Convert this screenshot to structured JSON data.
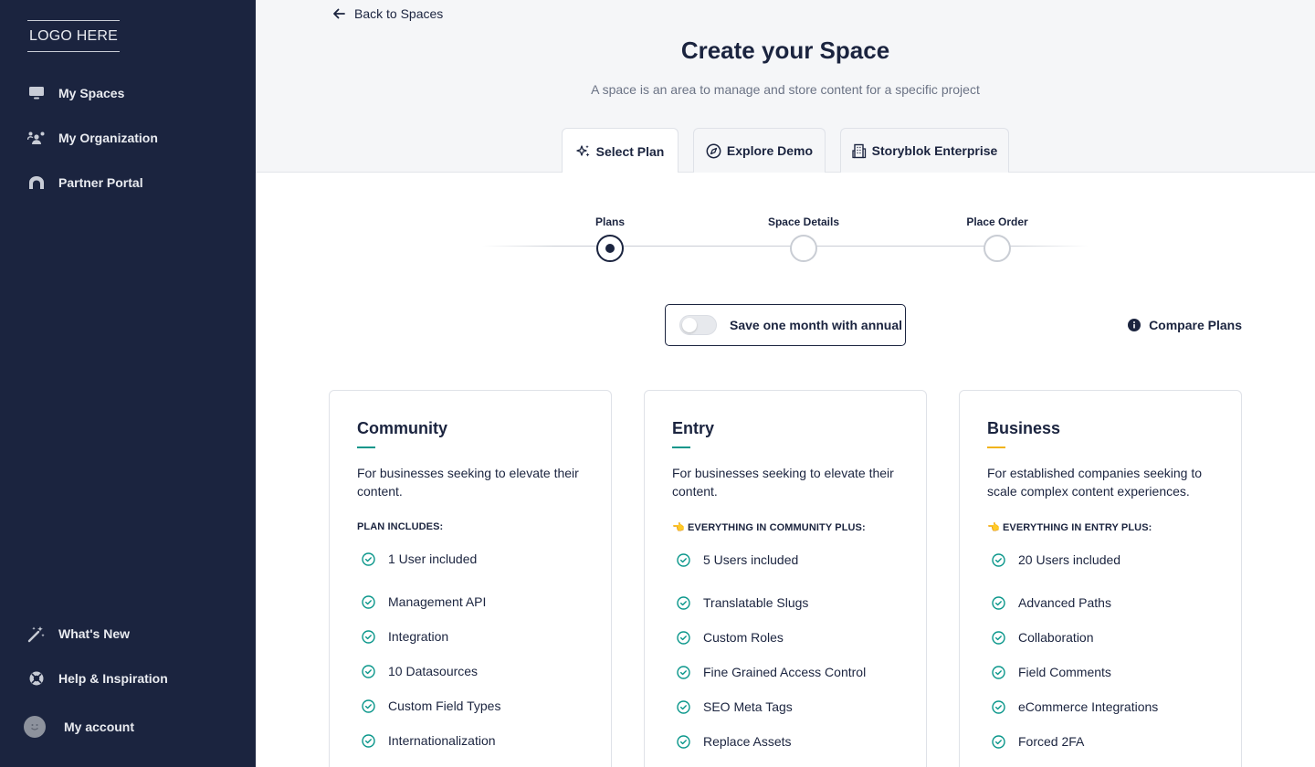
{
  "sidebar": {
    "logo": "LOGO HERE",
    "items": [
      {
        "label": "My Spaces",
        "icon": "monitor-icon"
      },
      {
        "label": "My Organization",
        "icon": "users-icon"
      },
      {
        "label": "Partner Portal",
        "icon": "partner-icon"
      }
    ],
    "bottom_items": [
      {
        "label": "What's New",
        "icon": "magic-wand-icon"
      },
      {
        "label": "Help & Inspiration",
        "icon": "lifebuoy-icon"
      }
    ],
    "account_label": "My account"
  },
  "header": {
    "back_label": "Back to Spaces",
    "title": "Create your Space",
    "subtitle": "A space is an area to manage and store content for a specific project"
  },
  "tabs": [
    {
      "label": "Select Plan",
      "icon": "sparkles-icon",
      "active": true
    },
    {
      "label": "Explore Demo",
      "icon": "compass-icon",
      "active": false
    },
    {
      "label": "Storyblok Enterprise",
      "icon": "building-icon",
      "active": false
    }
  ],
  "stepper": {
    "steps": [
      "Plans",
      "Space Details",
      "Place Order"
    ],
    "current": 0
  },
  "billing": {
    "toggle_label": "Save one month with annual",
    "annual_enabled": false,
    "compare_label": "Compare Plans"
  },
  "plans": [
    {
      "name": "Community",
      "accent": "#09968a",
      "description": "For businesses seeking to elevate their content.",
      "includes": "PLAN INCLUDES:",
      "features": [
        "1 User included",
        "Management API",
        "Integration",
        "10 Datasources",
        "Custom Field Types",
        "Internationalization"
      ]
    },
    {
      "name": "Entry",
      "accent": "#09968a",
      "description": "For businesses seeking to elevate their content.",
      "includes": "👈 EVERYTHING IN COMMUNITY PLUS:",
      "features": [
        "5 Users included",
        "Translatable Slugs",
        "Custom Roles",
        "Fine Grained Access Control",
        "SEO Meta Tags",
        "Replace Assets"
      ]
    },
    {
      "name": "Business",
      "accent": "#f1b31a",
      "description": "For established companies seeking to scale complex content experiences.",
      "includes": "👈 EVERYTHING IN ENTRY PLUS:",
      "features": [
        "20 Users included",
        "Advanced Paths",
        "Collaboration",
        "Field Comments",
        "eCommerce Integrations",
        "Forced 2FA"
      ]
    }
  ],
  "colors": {
    "sidebar_bg": "#1b243f",
    "check": "#09968a",
    "text": "#1b243f"
  }
}
